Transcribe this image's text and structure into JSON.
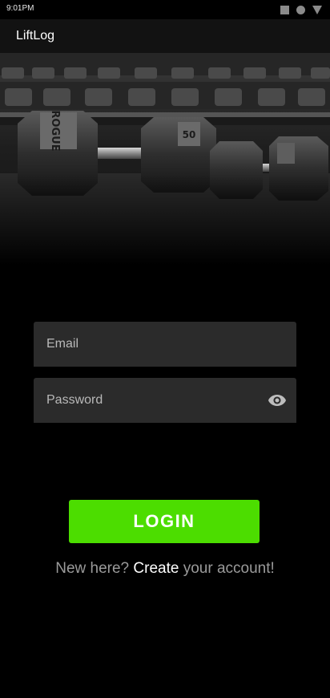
{
  "status_bar": {
    "time": "9:01PM",
    "icons": [
      "stop-square-icon",
      "record-circle-icon",
      "signal-triangle-icon"
    ]
  },
  "app_bar": {
    "title": "LiftLog"
  },
  "hero": {
    "image": "dumbbell-rack-photo",
    "dumbbell_label_1": "ROGUE",
    "dumbbell_label_2": "50"
  },
  "form": {
    "email_placeholder": "Email",
    "email_value": "",
    "password_placeholder": "Password",
    "password_value": "",
    "password_toggle_icon": "eye-icon"
  },
  "actions": {
    "login_label": "LOGIN",
    "signup_prefix": "New here?",
    "signup_link": "Create",
    "signup_suffix": "your account!"
  },
  "colors": {
    "background": "#000000",
    "app_bar": "#121212",
    "field_fill": "#2b2b2b",
    "accent_green": "#4cdd00",
    "muted_text": "#9a9a9a"
  }
}
